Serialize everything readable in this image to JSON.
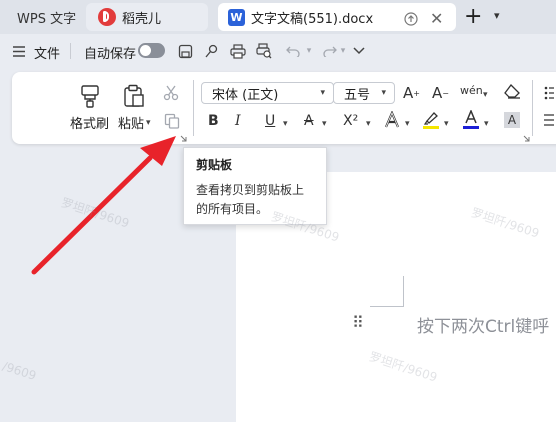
{
  "tabs": {
    "wps_label": "WPS 文字",
    "daoke_label": "稻壳儿",
    "doc_label": "文字文稿(551).docx",
    "doc_logo_letter": "W"
  },
  "quickbar": {
    "file_label": "文件",
    "autosave_label": "自动保存",
    "autosave_on": false
  },
  "ribbon": {
    "format_painter_label": "格式刷",
    "paste_label": "粘贴",
    "font_name": "宋体 (正文)",
    "font_size": "五号",
    "superscript_label": "X²",
    "pinyin_label": "wén"
  },
  "tooltip": {
    "title": "剪贴板",
    "body": "查看拷贝到剪贴板上的所有项目。"
  },
  "document": {
    "hint_text": "按下两次Ctrl键呼"
  },
  "watermarks": [
    "罗坦阡/9609",
    "罗坦阡/9609",
    "罗坦阡/9609",
    "罗坦阡/9609",
    "/9609"
  ],
  "colors": {
    "highlight": "#f5e600",
    "font_color": "#1c1fd6",
    "arrow": "#e8232a",
    "tab_active": "#ffffff"
  }
}
